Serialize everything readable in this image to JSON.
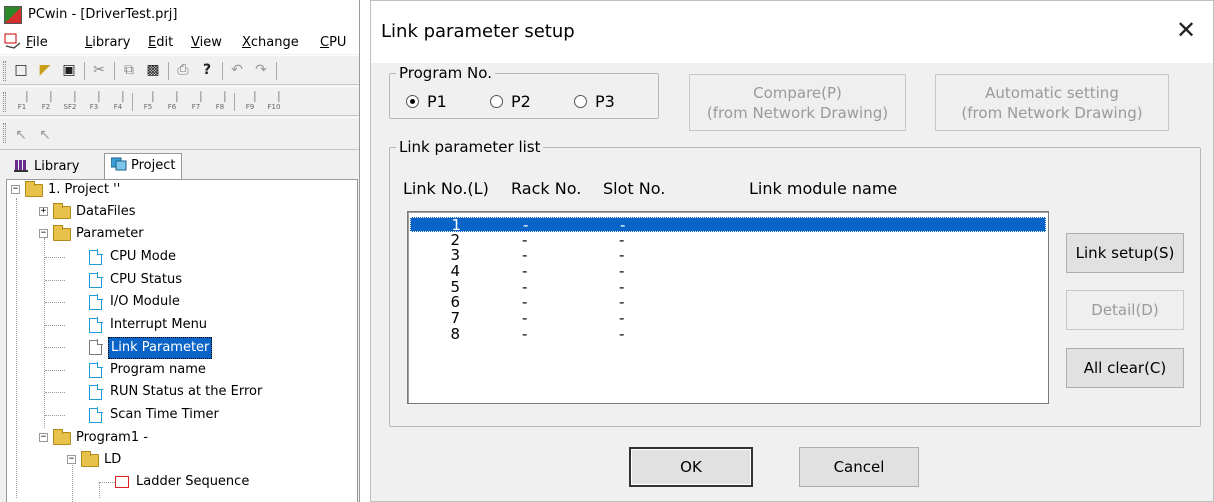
{
  "pcwin": {
    "title": "PCwin - [DriverTest.prj]",
    "menu": [
      {
        "key": "F",
        "rest": "ile"
      },
      {
        "key": "L",
        "rest": "ibrary"
      },
      {
        "key": "E",
        "rest": "dit"
      },
      {
        "key": "V",
        "rest": "iew"
      },
      {
        "key": "X",
        "rest": "change"
      },
      {
        "key": "C",
        "rest": "PU"
      }
    ],
    "toolbar_icons": [
      "new-icon",
      "open-icon",
      "save-icon",
      "cut-icon",
      "copy-icon",
      "paste-icon",
      "print-icon",
      "help-icon",
      "undo-icon",
      "redo-icon"
    ],
    "fkeys": [
      "F1",
      "F2",
      "SF2",
      "F3",
      "F4",
      "F5",
      "F6",
      "F7",
      "F8",
      "F9",
      "F10"
    ],
    "tabs": {
      "library": "Library",
      "project": "Project"
    },
    "tree": [
      {
        "label": "1. Project ''"
      },
      {
        "label": "DataFiles"
      },
      {
        "label": "Parameter"
      },
      {
        "label": "CPU Mode"
      },
      {
        "label": "CPU Status"
      },
      {
        "label": "I/O Module"
      },
      {
        "label": "Interrupt Menu"
      },
      {
        "label": "Link Parameter"
      },
      {
        "label": "Program name"
      },
      {
        "label": "RUN Status at the Error"
      },
      {
        "label": "Scan Time Timer"
      },
      {
        "label": "Program1 -"
      },
      {
        "label": "LD"
      },
      {
        "label": "Ladder Sequence"
      }
    ]
  },
  "dialog": {
    "title": "Link parameter setup",
    "program_group": {
      "label": "Program No.",
      "options": [
        {
          "label": "P1",
          "checked": true
        },
        {
          "label": "P2",
          "checked": false
        },
        {
          "label": "P3",
          "checked": false
        }
      ]
    },
    "compare_button": {
      "line1": "Compare(P)",
      "line2": "(from Network Drawing)"
    },
    "auto_button": {
      "line1": "Automatic setting",
      "line2": "(from Network Drawing)"
    },
    "list_group": {
      "label": "Link parameter list",
      "headers": {
        "link_no": "Link No.(L)",
        "rack": "Rack No.",
        "slot": "Slot No.",
        "module": "Link module name"
      },
      "rows": [
        {
          "no": "1",
          "rack": "-",
          "slot": "-",
          "module": ""
        },
        {
          "no": "2",
          "rack": "-",
          "slot": "-",
          "module": ""
        },
        {
          "no": "3",
          "rack": "-",
          "slot": "-",
          "module": ""
        },
        {
          "no": "4",
          "rack": "-",
          "slot": "-",
          "module": ""
        },
        {
          "no": "5",
          "rack": "-",
          "slot": "-",
          "module": ""
        },
        {
          "no": "6",
          "rack": "-",
          "slot": "-",
          "module": ""
        },
        {
          "no": "7",
          "rack": "-",
          "slot": "-",
          "module": ""
        },
        {
          "no": "8",
          "rack": "-",
          "slot": "-",
          "module": ""
        }
      ]
    },
    "link_setup_button": "Link setup(S)",
    "detail_button": "Detail(D)",
    "all_clear_button": "All clear(C)",
    "ok_button": "OK",
    "cancel_button": "Cancel"
  }
}
